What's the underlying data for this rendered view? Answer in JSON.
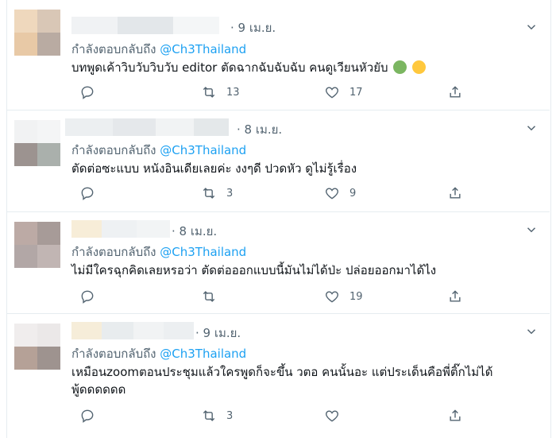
{
  "tweets": [
    {
      "date": "· 9 เม.ย.",
      "reply_label": "กำลังตอบกลับถึง ",
      "handle": "@Ch3Thailand",
      "text": "บทพูดเค้าวิบวับวิบวับ editor ตัดฉากฉับฉับฉับ คนดูเวียนหัวยับ",
      "emojis": [
        "nauseated-face-emoji",
        "dizzy-face-emoji"
      ],
      "reply_count": "",
      "retweet_count": "13",
      "like_count": "17"
    },
    {
      "date": "· 8 เม.ย.",
      "reply_label": "กำลังตอบกลับถึง ",
      "handle": "@Ch3Thailand",
      "text": "ตัดต่อซะแบบ หนังอินเดียเลยค่ะ งงๆดี ปวดหัว ดูไม่รู้เรื่อง",
      "reply_count": "",
      "retweet_count": "3",
      "like_count": "9"
    },
    {
      "date": "· 8 เม.ย.",
      "reply_label": "กำลังตอบกลับถึง ",
      "handle": "@Ch3Thailand",
      "text": "ไม่มีใครฉุกคิดเลยหรอว่า ตัดต่อออกแบบนี้มันไม่ได้ป่ะ ปล่อยออกมาได้ไง",
      "reply_count": "",
      "retweet_count": "",
      "like_count": "19"
    },
    {
      "date": "· 9 เม.ย.",
      "reply_label": "กำลังตอบกลับถึง ",
      "handle": "@Ch3Thailand",
      "text": "เหมือนzoomตอนประชุมแล้วใครพูดก็จะขึ้น วตอ คนนั้นอะ แต่ประเด็นคือพี่ติ๊กไม่ได้",
      "text2": "พู้ดดดดดด",
      "reply_count": "",
      "retweet_count": "3",
      "like_count": ""
    }
  ],
  "colors": {
    "handle": "#1da1f2",
    "muted": "#536471",
    "border": "#e6ecf0"
  }
}
